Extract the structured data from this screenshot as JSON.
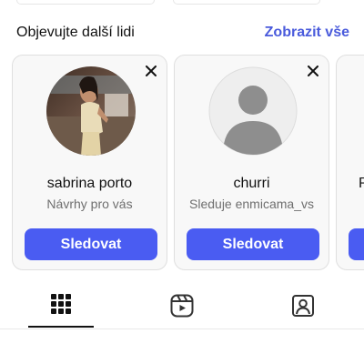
{
  "section": {
    "title": "Objevujte další lidi",
    "see_all": "Zobrazit vše"
  },
  "suggestions": [
    {
      "name": "sabrina porto",
      "subtitle": "Návrhy pro vás",
      "button": "Sledovat",
      "avatar": "photo-avatar"
    },
    {
      "name": "churri",
      "subtitle": "Sleduje enmicama_vs",
      "button": "Sledovat",
      "avatar": "default-avatar"
    },
    {
      "name": "P",
      "subtitle": "",
      "button": "",
      "avatar": ""
    }
  ],
  "tabs": [
    {
      "icon": "grid-icon",
      "active": true
    },
    {
      "icon": "reels-icon",
      "active": false
    },
    {
      "icon": "tagged-icon",
      "active": false
    }
  ],
  "colors": {
    "accent": "#4a5bdc",
    "button": "#4a5cf2",
    "card_bg": "#f8f8f8",
    "subtitle": "#6f6f6f"
  }
}
